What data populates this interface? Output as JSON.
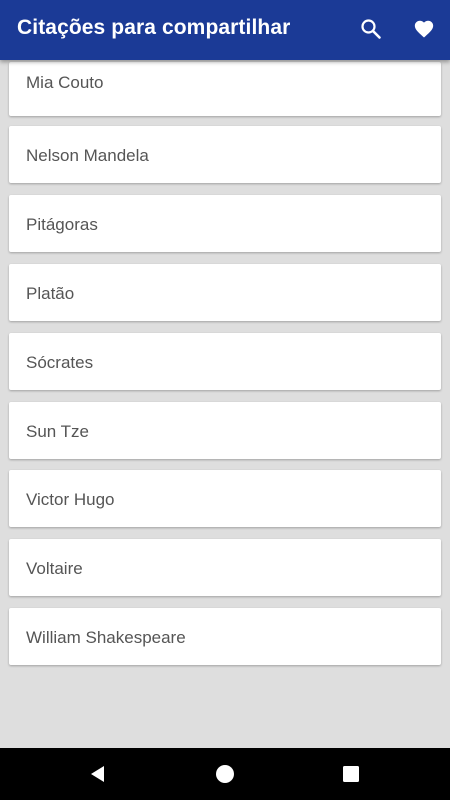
{
  "app_bar": {
    "title": "Citações para compartilhar",
    "background_color": "#1b3a96",
    "actions": [
      {
        "icon": "search-icon"
      },
      {
        "icon": "heart-icon"
      }
    ]
  },
  "authors": [
    "Mia Couto",
    "Nelson Mandela",
    "Pitágoras",
    "Platão",
    "Sócrates",
    "Sun Tze",
    "Victor Hugo",
    "Voltaire",
    "William Shakespeare"
  ],
  "nav_bar": {
    "buttons": [
      {
        "icon": "back-triangle-icon"
      },
      {
        "icon": "home-circle-icon"
      },
      {
        "icon": "recents-square-icon"
      }
    ]
  }
}
